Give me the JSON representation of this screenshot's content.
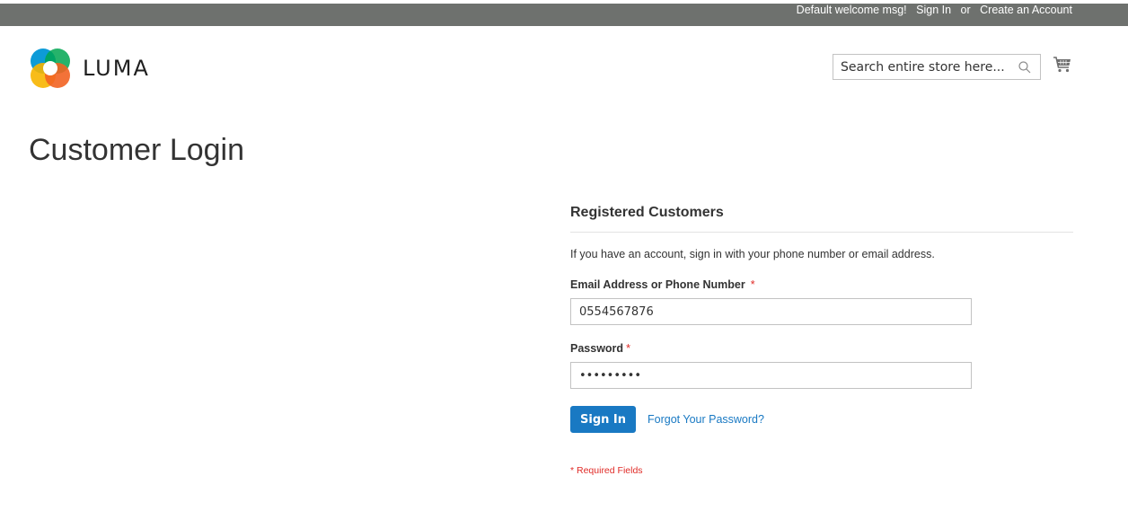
{
  "header": {
    "welcome": "Default welcome msg!",
    "sign_in": "Sign In",
    "or": "or",
    "create_account": "Create an Account"
  },
  "logo": {
    "text": "LUMA",
    "colors": {
      "orange": "#f26322",
      "blue": "#0096d6",
      "green": "#00a651",
      "yellow": "#f7b500"
    }
  },
  "search": {
    "placeholder": "Search entire store here...",
    "icon": "search-icon"
  },
  "cart": {
    "icon": "cart-icon"
  },
  "page": {
    "title": "Customer Login"
  },
  "login": {
    "block_title": "Registered Customers",
    "intro": "If you have an account, sign in with your phone number or email address.",
    "email_label": "Email Address or Phone Number",
    "email_value": "0554567876",
    "password_label": "Password",
    "password_value": "123456789",
    "required_marker": "*",
    "sign_in_button": "Sign In",
    "forgot_link": "Forgot Your Password?",
    "required_note": "* Required Fields"
  },
  "colors": {
    "topbar": "#6e716e",
    "primary": "#1979c3",
    "required": "#e02b27"
  }
}
